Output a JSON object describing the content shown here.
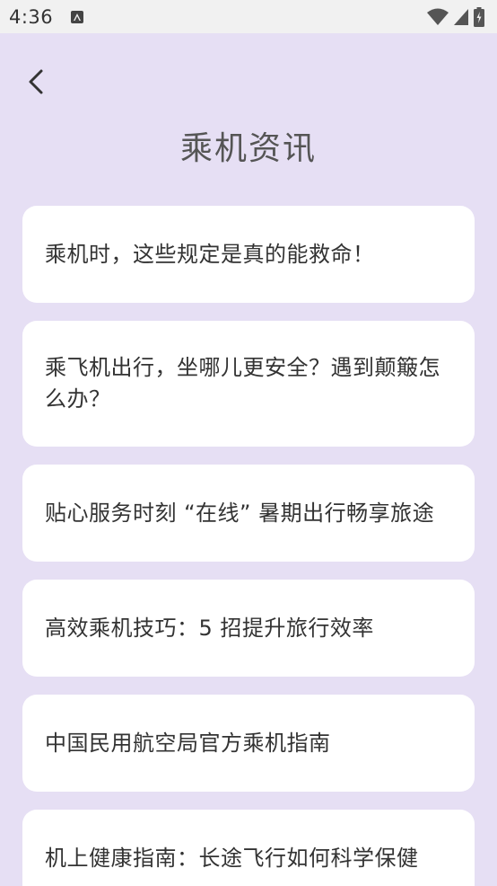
{
  "status_bar": {
    "time": "4:36",
    "icons": [
      "notification-a-icon",
      "wifi-icon",
      "cell-signal-icon",
      "battery-icon"
    ]
  },
  "header": {
    "back_icon": "chevron-left-icon",
    "title": "乘机资讯"
  },
  "articles": [
    {
      "title": "乘机时，这些规定是真的能救命！"
    },
    {
      "title": "乘飞机出行，坐哪儿更安全？遇到颠簸怎么办？"
    },
    {
      "title": "贴心服务时刻 “在线” 暑期出行畅享旅途"
    },
    {
      "title": "高效乘机技巧：5 招提升旅行效率"
    },
    {
      "title": "中国民用航空局官方乘机指南"
    },
    {
      "title": "机上健康指南：长途飞行如何科学保健"
    }
  ],
  "colors": {
    "background": "#e6dff4",
    "card": "#ffffff",
    "status_bar": "#f1f1f1"
  }
}
